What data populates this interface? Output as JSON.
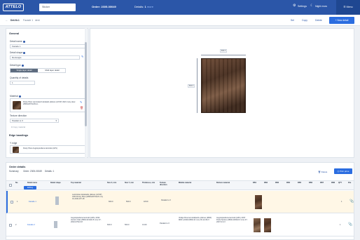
{
  "topbar": {
    "logo": "ATTELO",
    "search_value": "Sticker",
    "order_title": "Order: 2305-00049",
    "details_label": "Details:",
    "details_count": "1",
    "details_suffix": "more",
    "settings_label": "Settings",
    "night_mode_label": "Night mow",
    "menu_label": "Menu"
  },
  "subbar": {
    "crumbs": [
      "Det.Nr.1",
      "Facade 1",
      "dent"
    ],
    "actions": [
      "Sel",
      "Copy",
      "Delete"
    ],
    "new_detail_label": "New detail"
  },
  "general": {
    "title": "General",
    "detail_name_label": "Detail name",
    "detail_name_value": "Facade 1",
    "detail_shape_label": "Detail shape",
    "detail_shape_value": "Rectangle",
    "detail_type_label": "Detail type",
    "type_options": [
      "Single layer detail",
      "Multi layer detail"
    ],
    "quantity_label": "Quantity of details",
    "quantity_value": "1",
    "material_label": "Material",
    "material_text": "Rusty Plew Laminated kokskads plātnes (LKSP) 4321 rusty plew 2800x2070x18mm",
    "texture_label": "Texture direction",
    "texture_value": "Parallel to X",
    "copy_label": "Copy material",
    "edge_title": "Edge bandings",
    "edge_sublabel": "Y edge",
    "edge_text": "Rusty Plew Augstspiediena lamināts (HPL)"
  },
  "canvas": {
    "width_value": "600.0",
    "height_value": "500.0"
  },
  "orders": {
    "title": "Order details",
    "summary_label": "Summary",
    "order_label": "Order: 2305-00049",
    "details_label": "Details: 1",
    "delete_label": "Delete",
    "print_label": "Print price",
    "columns": [
      "No.",
      "Detail name",
      "Detail shape",
      "Top material",
      "Size X, mm",
      "Size Y, mm",
      "Thickness, mm",
      "Texture direction",
      "Middle material",
      "Bottom material",
      "DB1",
      "DB2",
      "DB3",
      "DB4",
      "DB5",
      "DB6",
      "DB7",
      "DB8",
      "QTY",
      "File"
    ],
    "editing_label": "Editing",
    "rows": [
      {
        "no": "1",
        "name": "Facade 1",
        "top_material": "Laminētas kokskaidu plātnes (LKSP) 4301 Rusty Plew (2800x2070x18 mm) 01-4321-RT-18",
        "size_x": "600.0",
        "size_y": "500.0",
        "thickness": "18.00",
        "texture": "Parallel to X",
        "middle_material": "",
        "bottom_material": "",
        "qty": "1"
      },
      {
        "no": "2",
        "name": "Facade 2",
        "top_material": "Augstspiediena lamināti (HPL) 2032 Hunton Oak (2800x1310x0.8 mm) 07-2032-0790-0.8",
        "size_x": "600.0",
        "size_y": "500.0",
        "thickness": "13.00",
        "texture": "Parallel to X",
        "middle_material": "Vidēja blīvuma kokšķiedru plātnes (MDF) MDF (2440x1830x12 mm) 00-12-09-X",
        "bottom_material": "Augstspiediena lamināti (HPL) 2037 Perla Santos (2800x1300x0.6 mm) 07-2037-0.6-X",
        "qty": "1"
      }
    ]
  }
}
